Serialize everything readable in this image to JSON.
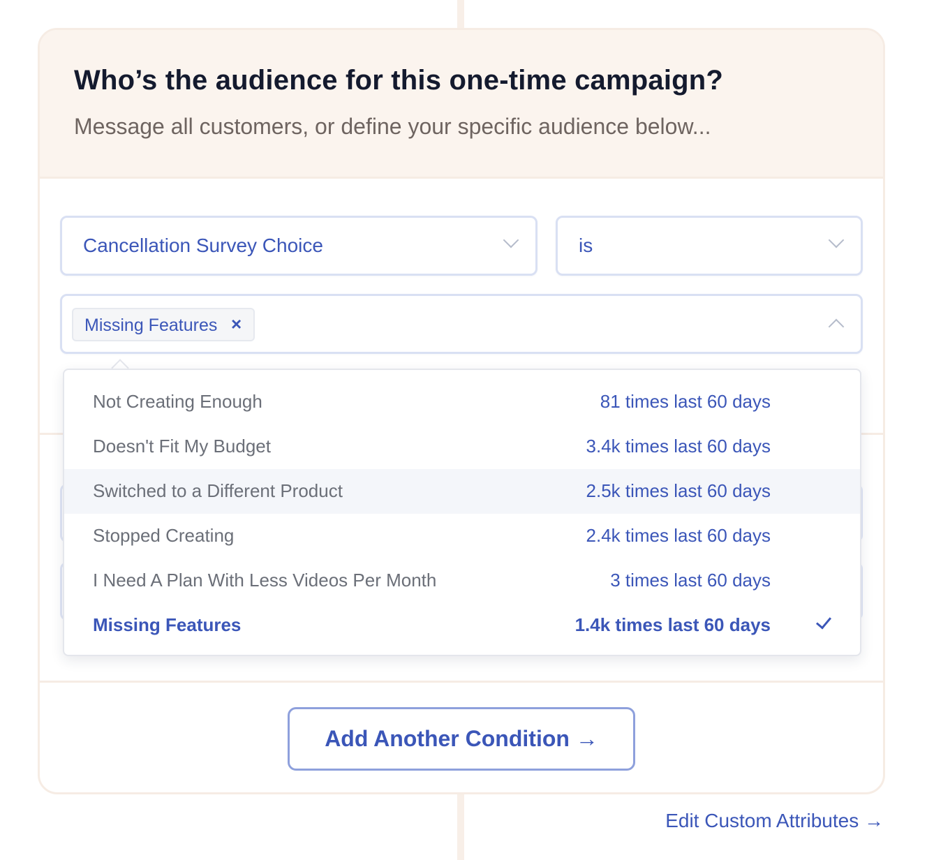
{
  "header": {
    "title": "Who’s the audience for this one-time campaign?",
    "subtitle": "Message all customers, or define your specific audience below..."
  },
  "condition": {
    "attribute": "Cancellation Survey Choice",
    "operator": "is",
    "selected_tags": [
      "Missing Features"
    ],
    "tag_remove_icon": "×"
  },
  "dropdown": {
    "options": [
      {
        "label": "Not Creating Enough",
        "count": "81 times last 60 days"
      },
      {
        "label": "Doesn't Fit My Budget",
        "count": "3.4k times last 60 days"
      },
      {
        "label": "Switched to a Different Product",
        "count": "2.5k times last 60 days"
      },
      {
        "label": "Stopped Creating",
        "count": "2.4k times last 60 days"
      },
      {
        "label": "I Need A Plan With Less Videos Per Month",
        "count": "3 times last 60 days"
      },
      {
        "label": "Missing Features",
        "count": "1.4k times last 60 days"
      }
    ]
  },
  "actions": {
    "add_condition": "Add Another Condition →",
    "edit_attributes": "Edit Custom Attributes →"
  },
  "colors": {
    "accent": "#3b56b8",
    "header_bg": "#fbf4ee",
    "border": "#f6ece4"
  }
}
